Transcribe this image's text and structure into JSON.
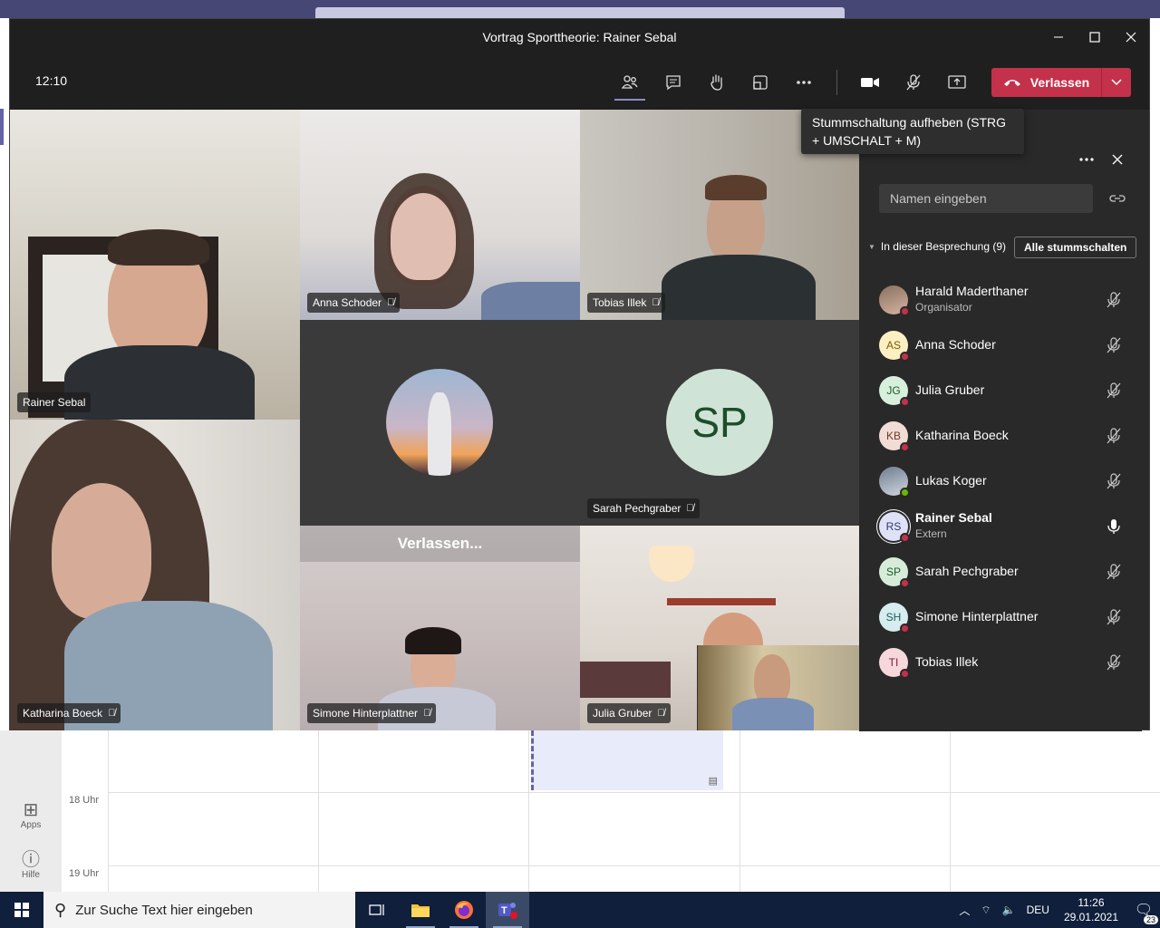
{
  "window": {
    "title": "Vortrag Sporttheorie: Rainer Sebal"
  },
  "toolbar": {
    "time": "12:10",
    "leave_label": "Verlassen"
  },
  "tooltip": {
    "text": "Stummschaltung aufheben (STRG + UMSCHALT + M)"
  },
  "tiles": {
    "rainer": "Rainer Sebal",
    "anna": "Anna Schoder",
    "tobias": "Tobias Illek",
    "sarah": "Sarah Pechgraber",
    "sarah_initials": "SP",
    "katharina": "Katharina Boeck",
    "simone": "Simone Hinterplattner",
    "simone_status": "Verlassen...",
    "julia": "Julia Gruber"
  },
  "panel": {
    "search_placeholder": "Namen eingeben",
    "section_label": "In dieser Besprechung (9)",
    "mute_all_label": "Alle stummschalten",
    "participants": [
      {
        "name": "Harald Maderthaner",
        "role": "Organisator",
        "initials": "",
        "status_color": "#c4314b"
      },
      {
        "name": "Anna Schoder",
        "role": "",
        "initials": "AS",
        "status_color": "#c4314b"
      },
      {
        "name": "Julia Gruber",
        "role": "",
        "initials": "JG",
        "status_color": "#c4314b"
      },
      {
        "name": "Katharina Boeck",
        "role": "",
        "initials": "KB",
        "status_color": "#c4314b"
      },
      {
        "name": "Lukas Koger",
        "role": "",
        "initials": "",
        "status_color": "#6bb700"
      },
      {
        "name": "Rainer Sebal",
        "role": "Extern",
        "initials": "RS",
        "status_color": "#c4314b"
      },
      {
        "name": "Sarah Pechgraber",
        "role": "",
        "initials": "SP",
        "status_color": "#c4314b"
      },
      {
        "name": "Simone Hinterplattner",
        "role": "",
        "initials": "SH",
        "status_color": "#c4314b"
      },
      {
        "name": "Tobias Illek",
        "role": "",
        "initials": "TI",
        "status_color": "#c4314b"
      }
    ]
  },
  "background": {
    "hour_18": "18 Uhr",
    "hour_19": "19 Uhr",
    "apps_label": "Apps",
    "help_label": "Hilfe"
  },
  "taskbar": {
    "search_placeholder": "Zur Suche Text hier eingeben",
    "language": "DEU",
    "clock_time": "11:26",
    "clock_date": "29.01.2021",
    "notification_count": "23"
  },
  "colors": {
    "leave_red": "#c4314b",
    "accent": "#6264a7",
    "window_bg": "#292929"
  }
}
